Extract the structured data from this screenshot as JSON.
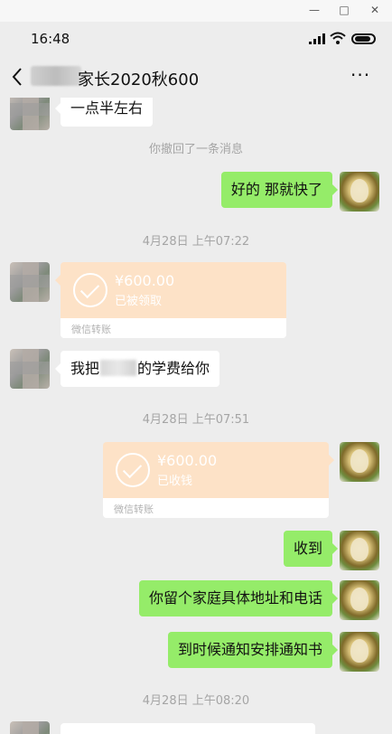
{
  "window": {
    "minimize_glyph": "—",
    "restore_glyph": "□",
    "close_glyph": "✕"
  },
  "status": {
    "time": "16:48",
    "icons": [
      "signal-icon",
      "wifi-icon",
      "battery-icon"
    ]
  },
  "header": {
    "title": "家长2020秋600",
    "back_icon": "chevron-left-icon",
    "more_label": "···"
  },
  "messages": {
    "m0": "一点半左右",
    "recall": "你撤回了一条消息",
    "m1": "好的 那就快了",
    "ts1": "4月28日 上午07:22",
    "t1_amount": "¥600.00",
    "t1_status": "已被领取",
    "t1_label": "微信转账",
    "m2_a": "我把",
    "m2_b": "的学费给你",
    "ts2": "4月28日 上午07:51",
    "t2_amount": "¥600.00",
    "t2_status": "已收钱",
    "t2_label": "微信转账",
    "m3": "收到",
    "m4": "你留个家庭具体地址和电话",
    "m5": "到时候通知安排通知书",
    "ts3": "4月28日 上午08:20"
  },
  "colors": {
    "background": "#ededed",
    "my_bubble": "#95ec69",
    "other_bubble": "#ffffff",
    "transfer_card": "#fde2c7",
    "timestamp_text": "#a5a5a5"
  }
}
